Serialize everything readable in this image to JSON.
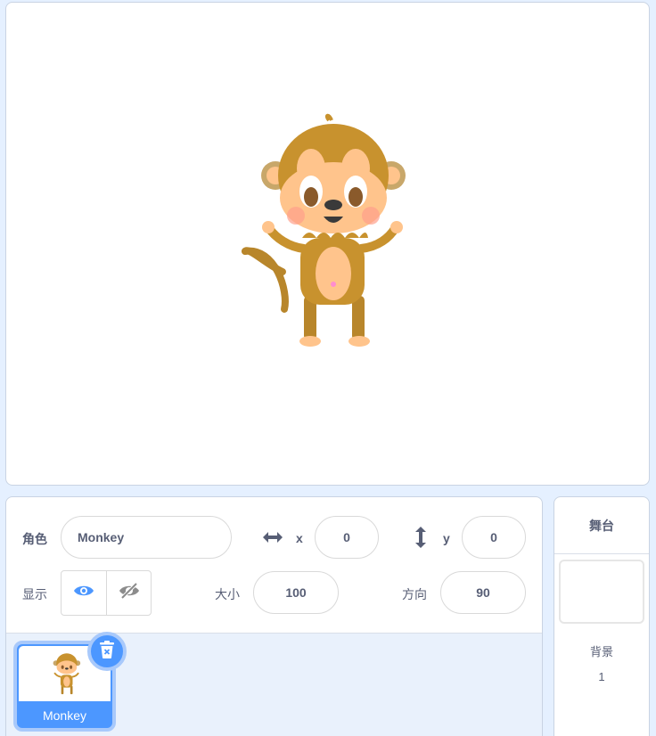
{
  "sprite_info": {
    "sprite_label": "角色",
    "sprite_name": "Monkey",
    "x_label": "x",
    "x_value": "0",
    "y_label": "y",
    "y_value": "0",
    "show_label": "显示",
    "size_label": "大小",
    "size_value": "100",
    "direction_label": "方向",
    "direction_value": "90"
  },
  "sprite_list": {
    "items": [
      {
        "name": "Monkey",
        "selected": true
      }
    ]
  },
  "stage_panel": {
    "title": "舞台",
    "backdrops_label": "背景",
    "backdrops_count": "1"
  },
  "colors": {
    "accent": "#4c97ff",
    "text": "#575e75",
    "background": "#e5f0ff"
  },
  "icons": {
    "x": "arrows-horizontal-icon",
    "y": "arrows-vertical-icon",
    "show": "eye-icon",
    "hide": "eye-slash-icon",
    "delete": "trash-icon"
  }
}
